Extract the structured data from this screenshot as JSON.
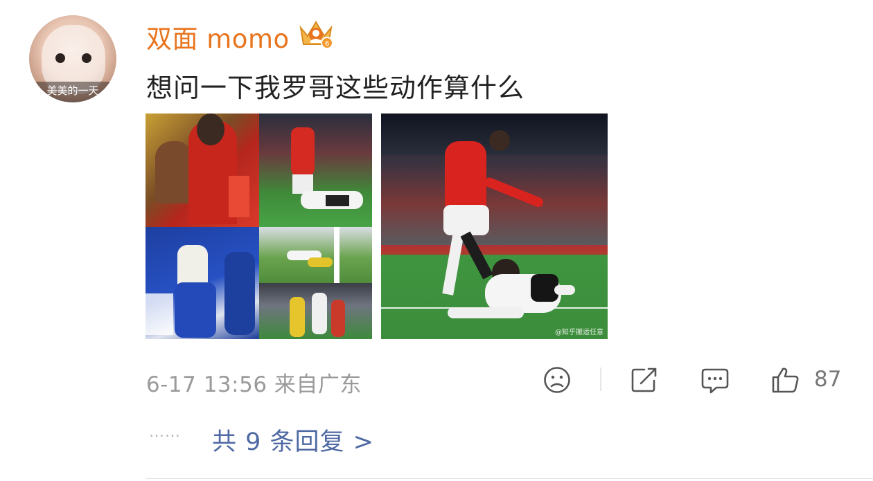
{
  "comment": {
    "avatar_caption": "美美的一天",
    "username": "双面 momo",
    "badge_icon": "vip-crown-badge-icon",
    "text": "想问一下我罗哥这些动作算什么",
    "image_watermark": "@知乎搬运任意"
  },
  "meta": {
    "date_time": "6-17 13:56",
    "location": "来自广东"
  },
  "actions": {
    "emoji_icon": "emoji-face-icon",
    "share_icon": "share-icon",
    "comment_icon": "comment-bubble-icon",
    "like_icon": "thumbs-up-icon",
    "like_count": "87"
  },
  "replies": {
    "dots": "……",
    "label": "共 9 条回复 >"
  },
  "colors": {
    "username": "#e8741e",
    "reply_link": "#4f6aa3",
    "meta_text": "#9a9a9a"
  }
}
